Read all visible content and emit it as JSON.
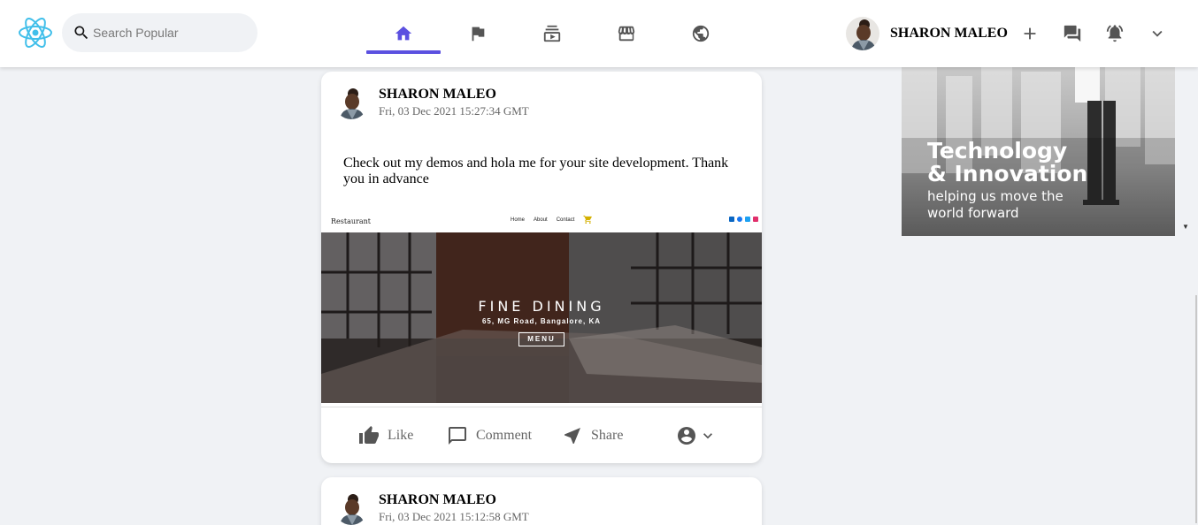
{
  "search": {
    "placeholder": "Search Popular"
  },
  "nav": {
    "tabs": [
      {
        "name": "home",
        "active": true
      },
      {
        "name": "flag"
      },
      {
        "name": "subscriptions"
      },
      {
        "name": "marketplace"
      },
      {
        "name": "groups"
      }
    ],
    "accent": "#5b50e0"
  },
  "header": {
    "user_name": "SHARON MALEO",
    "icons": [
      "add-icon",
      "chat-icon",
      "notifications-icon",
      "chevron-down-icon"
    ]
  },
  "posts": [
    {
      "author": "SHARON MALEO",
      "date": "Fri, 03 Dec 2021 15:27:34 GMT",
      "text": "Check out my demos and hola me for your site development. Thank you in advance",
      "image": {
        "brand": "Restaurant",
        "links": [
          "Home",
          "About",
          "Contact"
        ],
        "title": "FINE DINING",
        "subtitle": "65, MG Road, Bangalore, KA",
        "button": "MENU"
      },
      "actions": {
        "like": "Like",
        "comment": "Comment",
        "share": "Share"
      }
    },
    {
      "author": "SHARON MALEO",
      "date": "Fri, 03 Dec 2021 15:12:58 GMT"
    }
  ],
  "ad": {
    "line1": "Technology",
    "line2": "& Innovation",
    "line3": "helping us move the",
    "line4": "world forward"
  }
}
